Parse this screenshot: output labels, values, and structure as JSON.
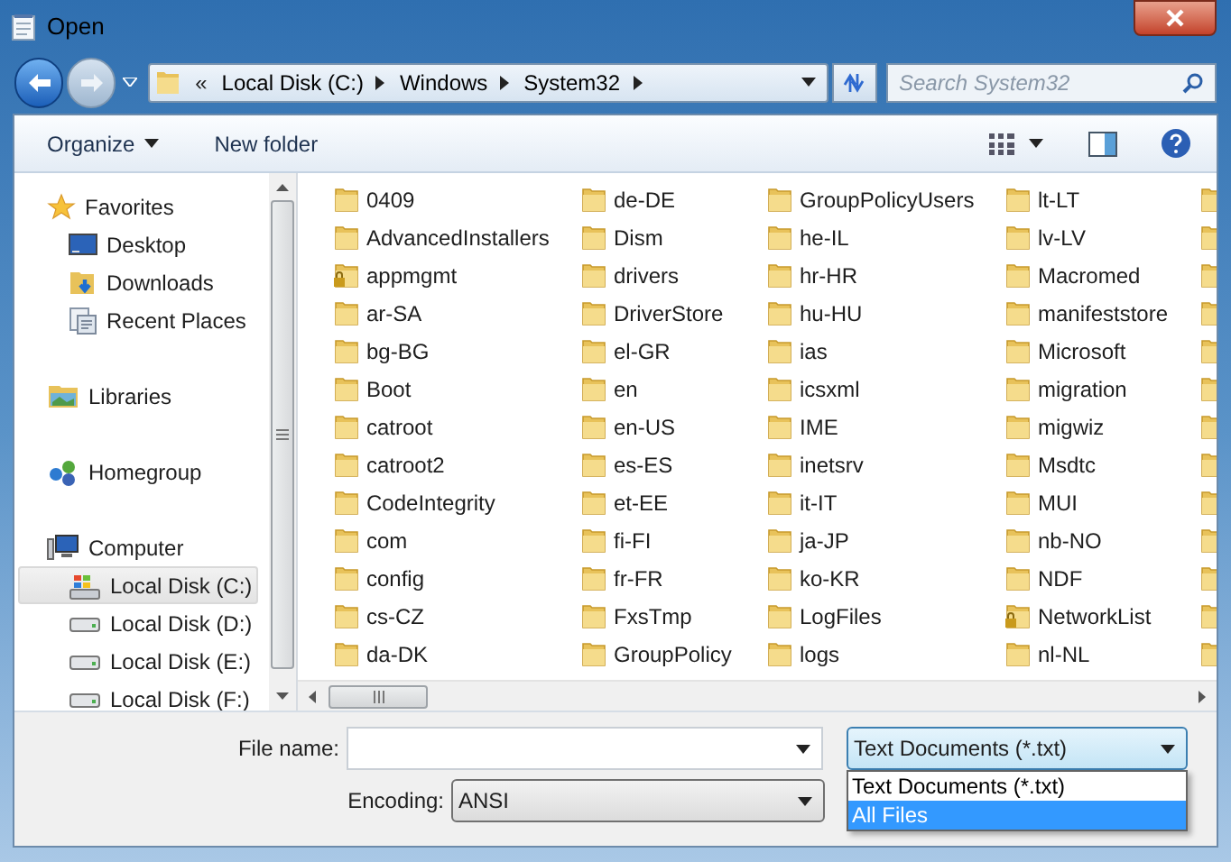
{
  "window": {
    "title": "Open"
  },
  "address": {
    "overflow": "«",
    "crumbs": [
      "Local Disk (C:)",
      "Windows",
      "System32"
    ]
  },
  "search": {
    "placeholder": "Search System32"
  },
  "toolbar": {
    "organize": "Organize",
    "new_folder": "New folder"
  },
  "sidebar": {
    "groups": [
      {
        "label": "Favorites",
        "kind": "star",
        "children": [
          {
            "label": "Desktop",
            "kind": "desktop",
            "selected": false
          },
          {
            "label": "Downloads",
            "kind": "downloads",
            "selected": false
          },
          {
            "label": "Recent Places",
            "kind": "recent",
            "selected": false
          }
        ]
      },
      {
        "label": "Libraries",
        "kind": "library"
      },
      {
        "label": "Homegroup",
        "kind": "homegroup"
      },
      {
        "label": "Computer",
        "kind": "computer",
        "children": [
          {
            "label": "Local Disk (C:)",
            "kind": "system-drive",
            "selected": true
          },
          {
            "label": "Local Disk (D:)",
            "kind": "drive",
            "selected": false
          },
          {
            "label": "Local Disk (E:)",
            "kind": "drive",
            "selected": false
          },
          {
            "label": "Local Disk (F:)",
            "kind": "drive",
            "selected": false
          }
        ]
      }
    ]
  },
  "files": {
    "columns": [
      [
        {
          "name": "0409",
          "locked": false
        },
        {
          "name": "AdvancedInstallers",
          "locked": false
        },
        {
          "name": "appmgmt",
          "locked": true
        },
        {
          "name": "ar-SA",
          "locked": false
        },
        {
          "name": "bg-BG",
          "locked": false
        },
        {
          "name": "Boot",
          "locked": false
        },
        {
          "name": "catroot",
          "locked": false
        },
        {
          "name": "catroot2",
          "locked": false
        },
        {
          "name": "CodeIntegrity",
          "locked": false
        },
        {
          "name": "com",
          "locked": false
        },
        {
          "name": "config",
          "locked": false
        },
        {
          "name": "cs-CZ",
          "locked": false
        },
        {
          "name": "da-DK",
          "locked": false
        }
      ],
      [
        {
          "name": "de-DE",
          "locked": false
        },
        {
          "name": "Dism",
          "locked": false
        },
        {
          "name": "drivers",
          "locked": false
        },
        {
          "name": "DriverStore",
          "locked": false
        },
        {
          "name": "el-GR",
          "locked": false
        },
        {
          "name": "en",
          "locked": false
        },
        {
          "name": "en-US",
          "locked": false
        },
        {
          "name": "es-ES",
          "locked": false
        },
        {
          "name": "et-EE",
          "locked": false
        },
        {
          "name": "fi-FI",
          "locked": false
        },
        {
          "name": "fr-FR",
          "locked": false
        },
        {
          "name": "FxsTmp",
          "locked": false
        },
        {
          "name": "GroupPolicy",
          "locked": false
        }
      ],
      [
        {
          "name": "GroupPolicyUsers",
          "locked": false
        },
        {
          "name": "he-IL",
          "locked": false
        },
        {
          "name": "hr-HR",
          "locked": false
        },
        {
          "name": "hu-HU",
          "locked": false
        },
        {
          "name": "ias",
          "locked": false
        },
        {
          "name": "icsxml",
          "locked": false
        },
        {
          "name": "IME",
          "locked": false
        },
        {
          "name": "inetsrv",
          "locked": false
        },
        {
          "name": "it-IT",
          "locked": false
        },
        {
          "name": "ja-JP",
          "locked": false
        },
        {
          "name": "ko-KR",
          "locked": false
        },
        {
          "name": "LogFiles",
          "locked": false
        },
        {
          "name": "logs",
          "locked": false
        }
      ],
      [
        {
          "name": "lt-LT",
          "locked": false
        },
        {
          "name": "lv-LV",
          "locked": false
        },
        {
          "name": "Macromed",
          "locked": false
        },
        {
          "name": "manifeststore",
          "locked": false
        },
        {
          "name": "Microsoft",
          "locked": false
        },
        {
          "name": "migration",
          "locked": false
        },
        {
          "name": "migwiz",
          "locked": false
        },
        {
          "name": "Msdtc",
          "locked": false
        },
        {
          "name": "MUI",
          "locked": false
        },
        {
          "name": "nb-NO",
          "locked": false
        },
        {
          "name": "NDF",
          "locked": false
        },
        {
          "name": "NetworkList",
          "locked": true
        },
        {
          "name": "nl-NL",
          "locked": false
        }
      ]
    ]
  },
  "file_name": {
    "label": "File name:"
  },
  "filter": {
    "value": "Text Documents (*.txt)",
    "expanded": true,
    "options": [
      {
        "label": "Text Documents (*.txt)",
        "highlighted": false
      },
      {
        "label": "All Files",
        "highlighted": true
      }
    ]
  },
  "encoding": {
    "label": "Encoding:",
    "value": "ANSI"
  }
}
